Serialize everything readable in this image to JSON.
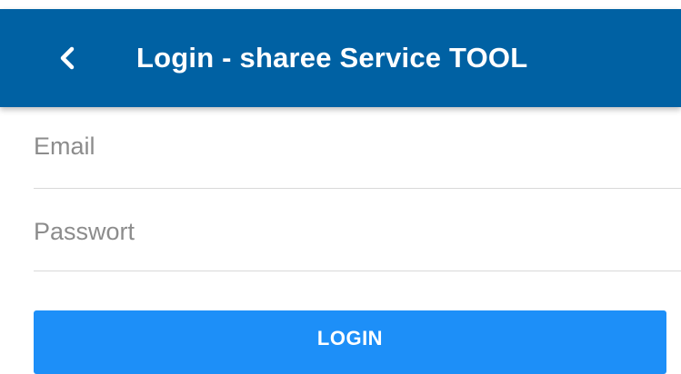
{
  "header": {
    "back_icon": "chevron-left-icon",
    "title": "Login - sharee Service TOOL",
    "background_color": "#0061a3"
  },
  "form": {
    "email": {
      "placeholder": "Email",
      "value": ""
    },
    "password": {
      "placeholder": "Passwort",
      "value": ""
    },
    "login_label": "LOGIN",
    "login_color": "#1d8ff8"
  }
}
